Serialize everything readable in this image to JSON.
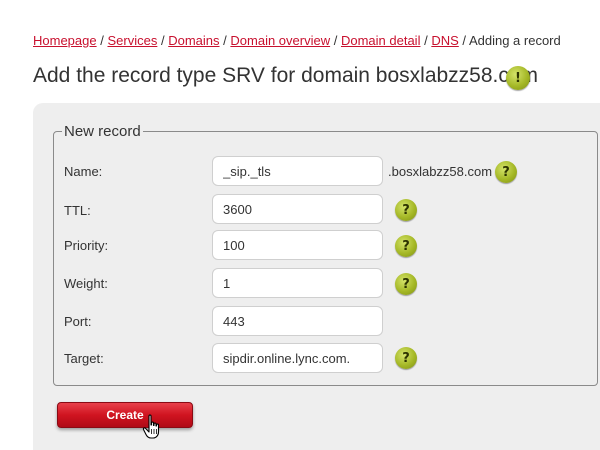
{
  "breadcrumb": {
    "items": [
      "Homepage",
      "Services",
      "Domains",
      "Domain overview",
      "Domain detail",
      "DNS"
    ],
    "separator": "/",
    "current": "Adding a record"
  },
  "page": {
    "title": "Add the record type SRV for domain bosxlabzz58.com",
    "info_icon_glyph": "!"
  },
  "form": {
    "legend": "New record",
    "help_glyph": "?",
    "fields": {
      "name": {
        "label": "Name:",
        "value": "_sip._tls",
        "suffix": ".bosxlabzz58.com"
      },
      "ttl": {
        "label": "TTL:",
        "value": "3600"
      },
      "priority": {
        "label": "Priority:",
        "value": "100"
      },
      "weight": {
        "label": "Weight:",
        "value": "1"
      },
      "port": {
        "label": "Port:",
        "value": "443"
      },
      "target": {
        "label": "Target:",
        "value": "sipdir.online.lync.com."
      }
    },
    "create_label": "Create"
  },
  "colors": {
    "link": "#c8102e",
    "accent_green": "#a5b826",
    "button_red": "#d01420",
    "panel_bg": "#eeeeee"
  },
  "icons": {
    "title_info": "info-icon",
    "field_help": "help-icon",
    "cursor": "hand-pointer-cursor"
  }
}
